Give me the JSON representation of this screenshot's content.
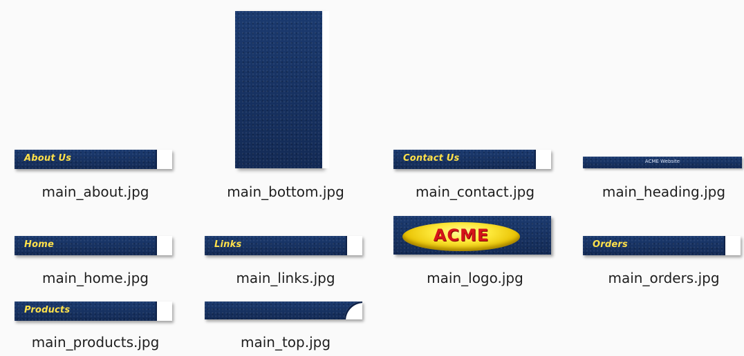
{
  "files": {
    "about": "main_about.jpg",
    "bottom": "main_bottom.jpg",
    "contact": "main_contact.jpg",
    "heading": "main_heading.jpg",
    "home": "main_home.jpg",
    "links": "main_links.jpg",
    "logo": "main_logo.jpg",
    "orders": "main_orders.jpg",
    "products": "main_products.jpg",
    "top": "main_top.jpg"
  },
  "thumb_text": {
    "about": "About Us",
    "contact": "Contact Us",
    "heading": "ACME Website",
    "home": "Home",
    "links": "Links",
    "logo": "ACME",
    "orders": "Orders",
    "products": "Products"
  },
  "colors": {
    "navy": "#16305e",
    "label_yellow": "#ffe14a",
    "logo_red": "#d6141a",
    "logo_gold": "#fde83a"
  }
}
